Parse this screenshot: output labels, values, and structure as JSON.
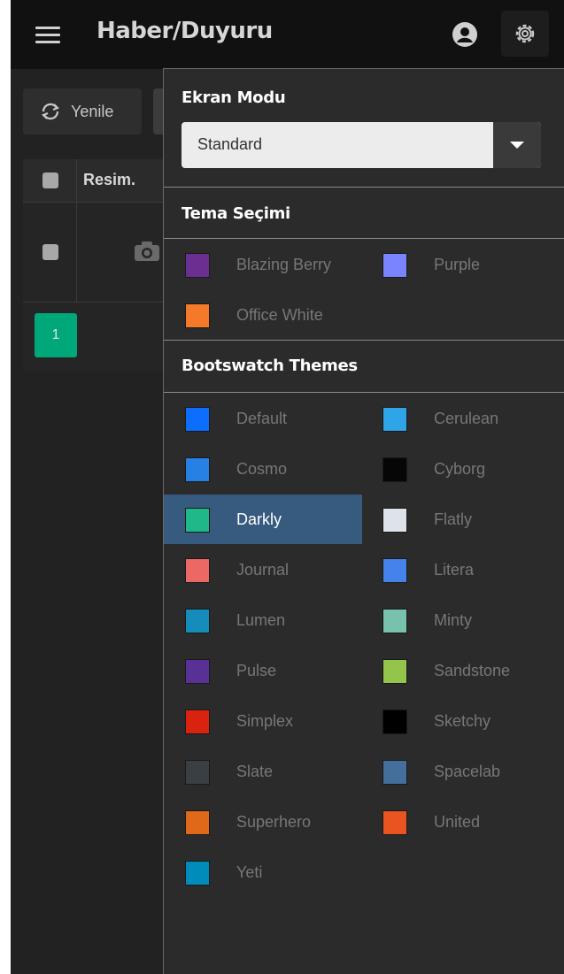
{
  "header": {
    "title": "Haber/Duyuru",
    "menu_icon": "hamburger-icon",
    "user_icon": "user-circle-icon",
    "settings_icon": "gear-icon"
  },
  "page": {
    "refresh_label": "Yenile",
    "refresh_icon": "refresh-icon",
    "table_header": "Resim.",
    "row_icon": "camera-icon",
    "pager_current": "1"
  },
  "settings": {
    "screen_mode_title": "Ekran Modu",
    "screen_mode_value": "Standard",
    "theme_title": "Tema Seçimi",
    "themes": [
      {
        "label": "Blazing Berry",
        "color": "#6b2f91"
      },
      {
        "label": "Purple",
        "color": "#7b84ff"
      },
      {
        "label": "Office White",
        "color": "#f47a2a"
      }
    ],
    "bootswatch_title": "Bootswatch Themes",
    "bootswatch": [
      {
        "label": "Default",
        "color": "#0d6efd"
      },
      {
        "label": "Cerulean",
        "color": "#2fa4e7"
      },
      {
        "label": "Cosmo",
        "color": "#2780e3"
      },
      {
        "label": "Cyborg",
        "color": "#060606"
      },
      {
        "label": "Darkly",
        "color": "#21b889",
        "active": true
      },
      {
        "label": "Flatly",
        "color": "#dde3e8"
      },
      {
        "label": "Journal",
        "color": "#eb6864"
      },
      {
        "label": "Litera",
        "color": "#4582ec"
      },
      {
        "label": "Lumen",
        "color": "#158cba"
      },
      {
        "label": "Minty",
        "color": "#78c2ad"
      },
      {
        "label": "Pulse",
        "color": "#593196"
      },
      {
        "label": "Sandstone",
        "color": "#93c54b"
      },
      {
        "label": "Simplex",
        "color": "#d9230f"
      },
      {
        "label": "Sketchy",
        "color": "#000000"
      },
      {
        "label": "Slate",
        "color": "#3a3f44"
      },
      {
        "label": "Spacelab",
        "color": "#446e9b"
      },
      {
        "label": "Superhero",
        "color": "#df6919"
      },
      {
        "label": "United",
        "color": "#e95420"
      },
      {
        "label": "Yeti",
        "color": "#008cba"
      }
    ]
  }
}
